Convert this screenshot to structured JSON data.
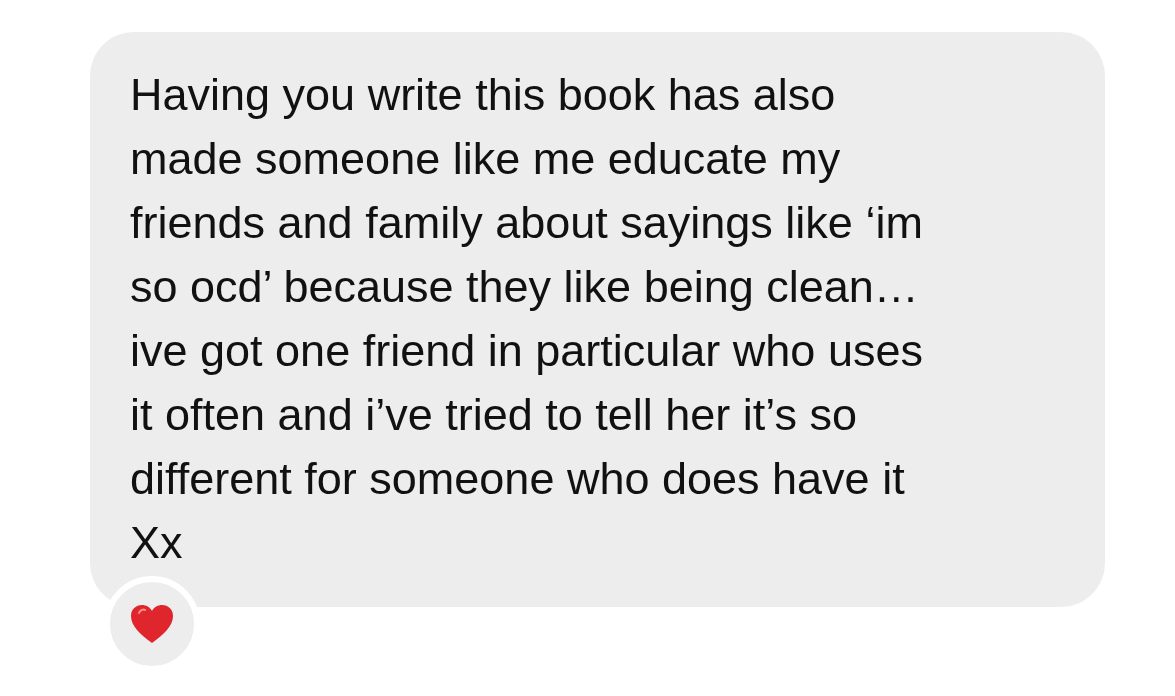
{
  "message": {
    "lines": [
      "Having you write this book has also",
      "made someone like me educate my",
      "friends and family about sayings like ‘im",
      "so ocd’ because they like being clean…",
      "ive got one friend in particular who uses",
      "it often and i’ve tried to tell her it’s so",
      "different for someone who does have it",
      "Xx"
    ],
    "reactions": [
      {
        "kind": "heart"
      }
    ]
  }
}
